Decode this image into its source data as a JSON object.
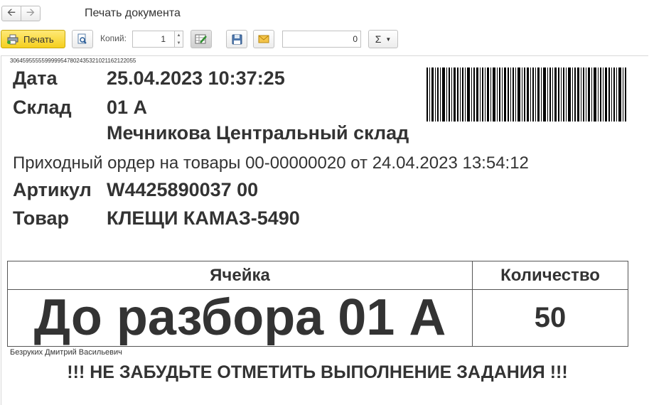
{
  "window": {
    "title": "Печать документа"
  },
  "toolbar": {
    "print_label": "Печать",
    "copies_label": "Копий:",
    "copies_value": "1",
    "number_value": "0",
    "sum_symbol": "Σ"
  },
  "document": {
    "code_line": "3064595555599999547802435321021162122055",
    "date_label": "Дата",
    "date_value": "25.04.2023 10:37:25",
    "warehouse_label": "Склад",
    "warehouse_value": "01 А",
    "warehouse_name": "Мечникова Центральный склад",
    "order_line": "Приходный ордер на товары 00-00000020 от 24.04.2023 13:54:12",
    "article_label": "Артикул",
    "article_value": "W4425890037 00",
    "product_label": "Товар",
    "product_value": "КЛЕЩИ КАМАЗ-5490",
    "table": {
      "col_cell": "Ячейка",
      "col_qty": "Количество",
      "cell_value": "До разбора 01 А",
      "qty_value": "50"
    },
    "executor": "Безруких Дмитрий Васильевич",
    "reminder": "!!! НЕ ЗАБУДЬТЕ ОТМЕТИТЬ ВЫПОЛНЕНИЕ ЗАДАНИЯ !!!"
  },
  "colors": {
    "print_button": "#f5cf1e",
    "text": "#333333"
  }
}
